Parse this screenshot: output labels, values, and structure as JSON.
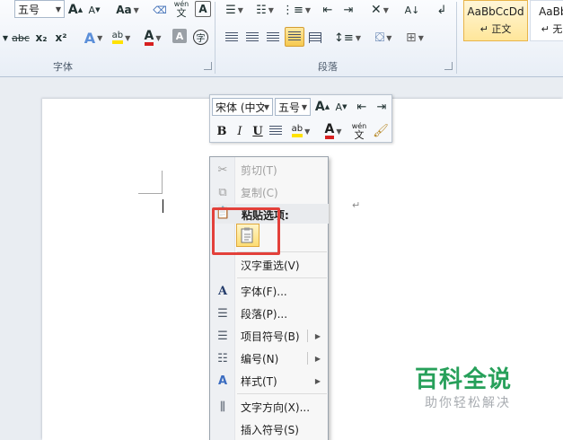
{
  "ribbon": {
    "font_size_combo": "五号",
    "normal_style": {
      "preview": "AaBbCcDd",
      "name": "↵ 正文"
    },
    "nospace_style": {
      "preview": "AaBbC",
      "name": "↵ 无间"
    },
    "groups": {
      "font": "字体",
      "paragraph": "段落"
    },
    "font_buttons_row1": [
      "A",
      "A",
      "Aa",
      "wén",
      "A"
    ],
    "font_buttons_row2": [
      "abc",
      "x₂",
      "x²",
      "A",
      "ab",
      "A",
      "A",
      "字"
    ]
  },
  "mini_toolbar": {
    "font_name": "宋体 (中文",
    "font_size": "五号",
    "bold": "B",
    "italic": "I",
    "underline": "U",
    "highlight": "ab",
    "font_color": "A",
    "phonetic_top": "wén",
    "phonetic_bottom": "文"
  },
  "context_menu": {
    "items": [
      {
        "label": "剪切(T)",
        "icon": "scissors-icon",
        "disabled": true
      },
      {
        "label": "复制(C)",
        "icon": "copy-icon",
        "disabled": true
      },
      {
        "label": "粘贴选项:",
        "icon": "paste-icon"
      },
      {
        "label": "汉字重选(V)"
      },
      {
        "label": "字体(F)...",
        "icon": "font-icon"
      },
      {
        "label": "段落(P)...",
        "icon": "paragraph-icon"
      },
      {
        "label": "项目符号(B)",
        "icon": "bullets-icon"
      },
      {
        "label": "编号(N)",
        "icon": "numbering-icon"
      },
      {
        "label": "样式(T)",
        "icon": "styles-icon"
      },
      {
        "label": "文字方向(X)...",
        "icon": "text-direction-icon"
      },
      {
        "label": "插入符号(S)"
      }
    ]
  },
  "watermark": {
    "title": "百科全说",
    "subtitle": "助你轻松解决"
  },
  "colors": {
    "accent": "#e3403a",
    "watermark": "#27a05a",
    "selected_style": "#ffe69a"
  }
}
